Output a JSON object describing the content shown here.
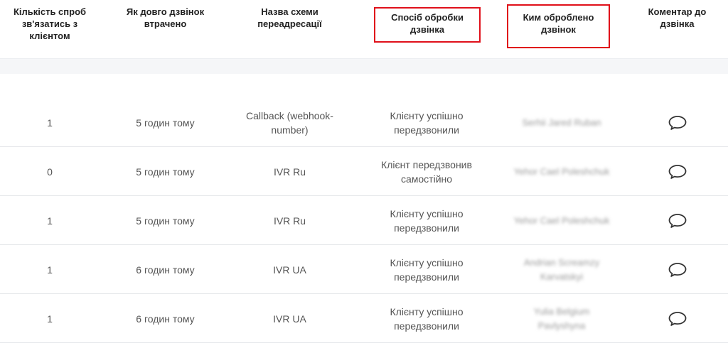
{
  "columns": [
    {
      "id": "attempts",
      "label": "Кількість спроб зв'язатись з клієнтом",
      "highlighted": false
    },
    {
      "id": "missed_ago",
      "label": "Як довго дзвінок втрачено",
      "highlighted": false
    },
    {
      "id": "scheme",
      "label": "Назва схеми переадресації",
      "highlighted": false
    },
    {
      "id": "method",
      "label": "Спосіб обробки дзвінка",
      "highlighted": true
    },
    {
      "id": "handled_by",
      "label": "Ким оброблено дзвінок",
      "highlighted": true
    },
    {
      "id": "comment",
      "label": "Коментар до дзвінка",
      "highlighted": false
    }
  ],
  "rows": [
    {
      "attempts": "1",
      "missed_ago": "5 годин тому",
      "scheme": "Callback (webhook-number)",
      "method": "Клієнту успішно передзвонили",
      "handled_by": "Serhii Jared Ruban",
      "comment_icon": "speech-bubble-icon"
    },
    {
      "attempts": "0",
      "missed_ago": "5 годин тому",
      "scheme": "IVR Ru",
      "method": "Клієнт передзвонив самостійно",
      "handled_by": "Yehor Cael Poleshchuk",
      "comment_icon": "speech-bubble-icon"
    },
    {
      "attempts": "1",
      "missed_ago": "5 годин тому",
      "scheme": "IVR Ru",
      "method": "Клієнту успішно передзвонили",
      "handled_by": "Yehor Cael Poleshchuk",
      "comment_icon": "speech-bubble-icon"
    },
    {
      "attempts": "1",
      "missed_ago": "6 годин тому",
      "scheme": "IVR UA",
      "method": "Клієнту успішно передзвонили",
      "handled_by": "Andrian Screamzy Karvatskyi",
      "comment_icon": "speech-bubble-icon"
    },
    {
      "attempts": "1",
      "missed_ago": "6 годин тому",
      "scheme": "IVR UA",
      "method": "Клієнту успішно передзвонили",
      "handled_by": "Yulia Belgium Pavlyshyna",
      "comment_icon": "speech-bubble-icon"
    }
  ],
  "colors": {
    "highlight_border": "#e0101a",
    "header_text": "#222222",
    "cell_text": "#555555",
    "row_divider": "#e6e8eb"
  }
}
